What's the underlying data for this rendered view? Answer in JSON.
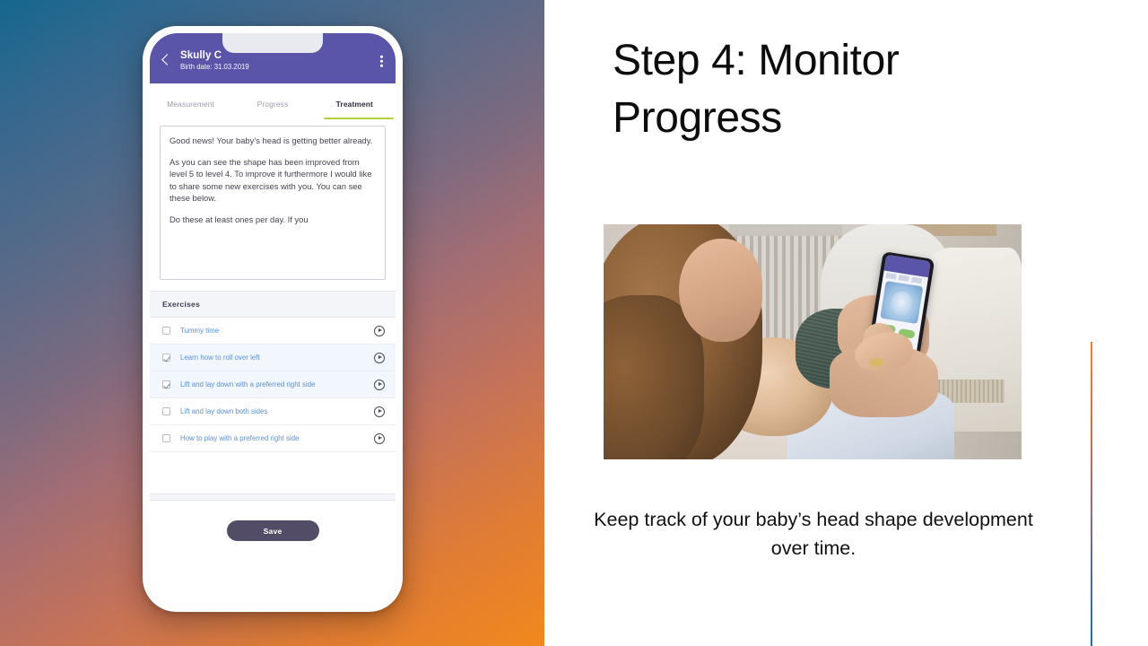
{
  "slide": {
    "heading": "Step 4: Monitor Progress",
    "caption": "Keep track of your baby’s head shape development over time."
  },
  "colors": {
    "app_header": "#5a55a8",
    "tab_active_underline": "#b2cf3e",
    "exercise_label": "#5b8fd4",
    "save_button": "#534c66",
    "gradient_start": "#15678e",
    "gradient_end": "#f1881d",
    "accent_line_top": "#ef7f2a",
    "accent_line_bottom": "#1d6f9e"
  },
  "phone_app": {
    "header": {
      "back_icon": "chevron-left-icon",
      "patient_name": "Skully C",
      "birth_date": "Birth date: 31.03.2019",
      "menu_icon": "kebab-menu-icon"
    },
    "tabs": [
      {
        "label": "Measurement",
        "active": false
      },
      {
        "label": "Progress",
        "active": false
      },
      {
        "label": "Treatment",
        "active": true
      }
    ],
    "message": {
      "paragraphs": [
        "Good news! Your baby’s head is getting better already.",
        "As you can see the shape has been improved from level 5 to level 4. To improve it furthermore I would like to share some new exercises with you. You can see these below.",
        "Do these at least ones per day. If you"
      ]
    },
    "exercises_section_title": "Exercises",
    "exercises": [
      {
        "label": "Tummy time",
        "checked": false,
        "play_icon": "play-circle-icon"
      },
      {
        "label": "Learn how to roll over left",
        "checked": true,
        "play_icon": "play-circle-icon"
      },
      {
        "label": "Lift and lay down with a preferred right side",
        "checked": true,
        "play_icon": "play-circle-icon"
      },
      {
        "label": "Lift and lay down both sides",
        "checked": false,
        "play_icon": "play-circle-icon"
      },
      {
        "label": "How to play with a preferred right side",
        "checked": false,
        "play_icon": "play-circle-icon"
      }
    ],
    "save_label": "Save"
  },
  "photo": {
    "alt": "Mother holding a baby while viewing the head-shape app on a smartphone"
  }
}
